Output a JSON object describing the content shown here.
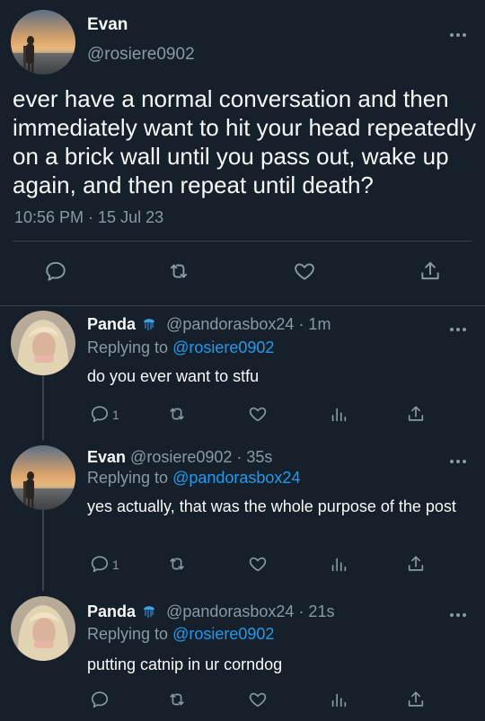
{
  "main_tweet": {
    "author_name": "Evan",
    "author_handle": "@rosiere0902",
    "text": "ever have a normal conversation and then immediately want to hit your head repeatedly on a brick wall until you pass out, wake up again, and then repeat until death?",
    "timestamp": "10:56 PM · 15 Jul 23",
    "actions": [
      "reply-icon",
      "retweet-icon",
      "like-icon",
      "share-icon"
    ]
  },
  "replies": [
    {
      "author_name": "Panda",
      "emoji": "jellyfish",
      "handle_time": "@pandorasbox24 · 1m",
      "replying_prefix": "Replying to",
      "replying_to": "@rosiere0902",
      "text": "do you ever want to stfu",
      "reply_count": "1"
    },
    {
      "author_name": "Evan",
      "handle_time": "@rosiere0902 · 35s",
      "replying_prefix": "Replying to",
      "replying_to": "@pandorasbox24",
      "text": "yes actually, that was the whole purpose of the post",
      "reply_count": "1"
    },
    {
      "author_name": "Panda",
      "emoji": "jellyfish",
      "handle_time": "@pandorasbox24 · 21s",
      "replying_prefix": "Replying to",
      "replying_to": "@rosiere0902",
      "text": "putting catnip in ur corndog",
      "reply_count": ""
    }
  ],
  "colors": {
    "background": "#15202b",
    "text": "#f7f9f9",
    "muted": "#8b98a5",
    "link": "#1d9bf0",
    "divider": "#38444d"
  }
}
